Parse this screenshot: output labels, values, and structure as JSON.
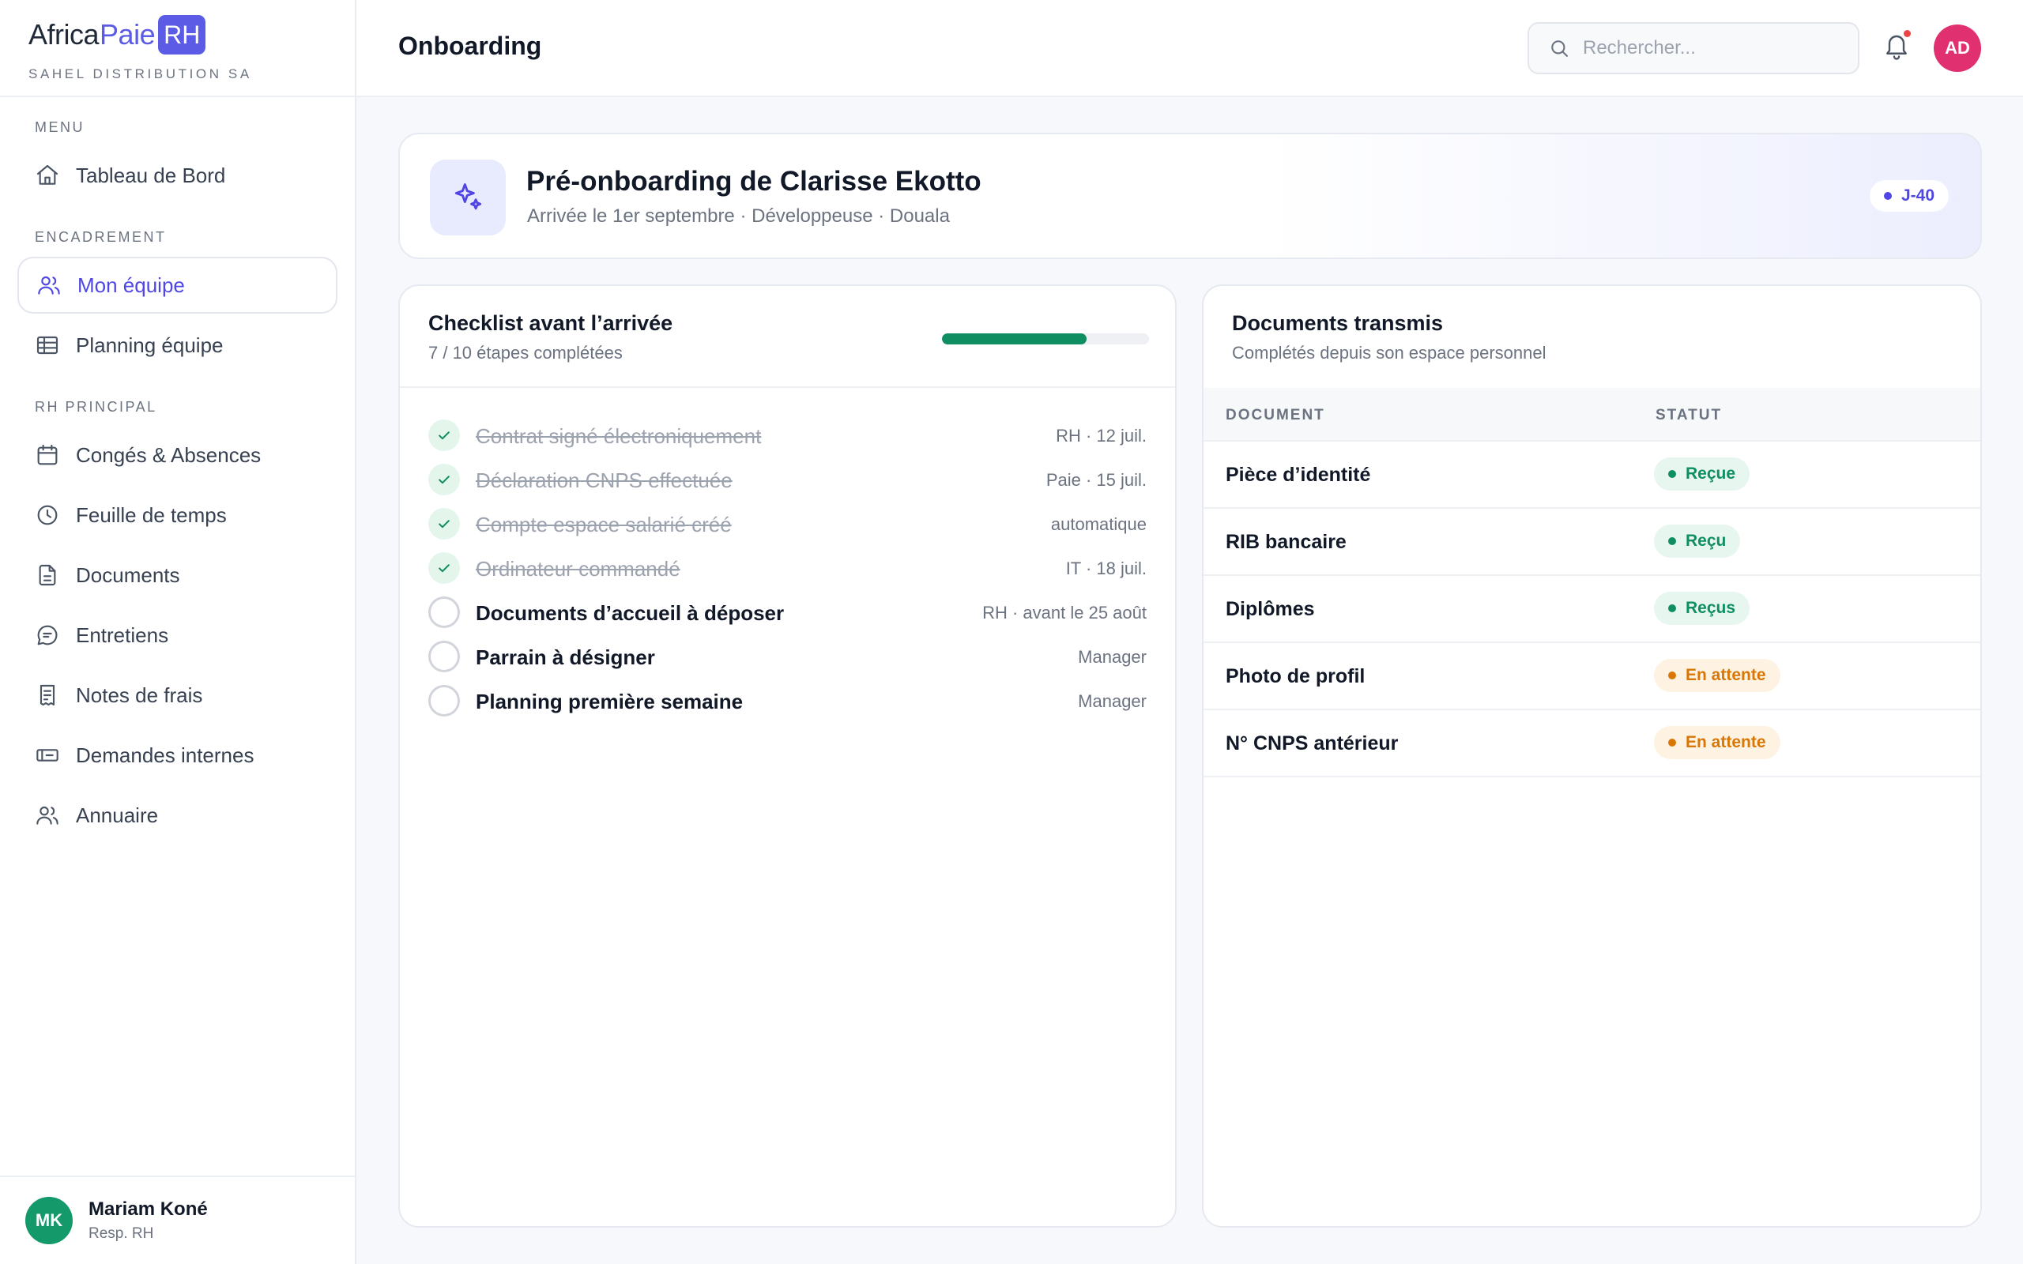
{
  "brand": {
    "logo_part1": "Africa",
    "logo_part2": "Paie",
    "logo_badge": "RH",
    "company": "SAHEL DISTRIBUTION SA"
  },
  "nav": {
    "menu_label": "MENU",
    "dashboard": "Tableau de Bord",
    "encadrement_label": "ENCADREMENT",
    "team": "Mon équipe",
    "team_planning": "Planning équipe",
    "rh_label": "RH PRINCIPAL",
    "leaves": "Congés & Absences",
    "timesheet": "Feuille de temps",
    "documents": "Documents",
    "interviews": "Entretiens",
    "expenses": "Notes de frais",
    "requests": "Demandes internes",
    "directory": "Annuaire"
  },
  "user": {
    "initials": "MK",
    "name": "Mariam Koné",
    "role": "Resp. RH"
  },
  "topbar": {
    "title": "Onboarding",
    "search_placeholder": "Rechercher...",
    "avatar_initials": "AD"
  },
  "hero": {
    "title": "Pré-onboarding de Clarisse Ekotto",
    "subtitle": "Arrivée le 1er septembre · Développeuse · Douala",
    "badge": "J-40"
  },
  "checklist": {
    "title": "Checklist avant l’arrivée",
    "subtitle": "7 / 10 étapes complétées",
    "progress": 0.7,
    "items": [
      {
        "label": "Contrat signé électroniquement",
        "meta": "RH · 12 juil.",
        "done": true
      },
      {
        "label": "Déclaration CNPS effectuée",
        "meta": "Paie · 15 juil.",
        "done": true
      },
      {
        "label": "Compte espace salarié créé",
        "meta": "automatique",
        "done": true
      },
      {
        "label": "Ordinateur commandé",
        "meta": "IT · 18 juil.",
        "done": true
      },
      {
        "label": "Documents d’accueil à déposer",
        "meta": "RH · avant le 25 août",
        "done": false
      },
      {
        "label": "Parrain à désigner",
        "meta": "Manager",
        "done": false
      },
      {
        "label": "Planning première semaine",
        "meta": "Manager",
        "done": false
      }
    ]
  },
  "documents": {
    "title": "Documents transmis",
    "subtitle": "Complétés depuis son espace personnel",
    "col_document": "DOCUMENT",
    "col_status": "STATUT",
    "rows": [
      {
        "name": "Pièce d’identité",
        "status": "Reçue",
        "state": "ok"
      },
      {
        "name": "RIB bancaire",
        "status": "Reçu",
        "state": "ok"
      },
      {
        "name": "Diplômes",
        "status": "Reçus",
        "state": "ok"
      },
      {
        "name": "Photo de profil",
        "status": "En attente",
        "state": "wait"
      },
      {
        "name": "N° CNPS antérieur",
        "status": "En attente",
        "state": "wait"
      }
    ]
  },
  "colors": {
    "accent": "#4f46e5",
    "success": "#0f8f61",
    "warning": "#d97706",
    "avatar_user": "#13996a",
    "avatar_admin": "#e0306f"
  }
}
